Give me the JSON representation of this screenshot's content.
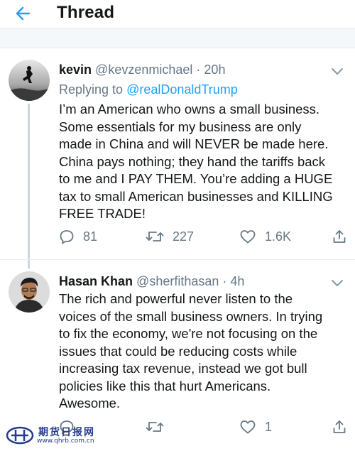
{
  "header": {
    "title": "Thread",
    "back_icon": "arrow-left-icon"
  },
  "tweets": [
    {
      "name": "kevin",
      "handle": "@kevzenmichael",
      "separator": "·",
      "time": "20h",
      "replying_prefix": "Replying to ",
      "replying_to": "@realDonaldTrump",
      "lines": [
        "I’m an American who owns a small business.",
        "Some essentials for my business are only",
        "made in China and will NEVER be made here.",
        "China pays nothing; they hand the tariffs back",
        "to me and I PAY THEM. You’re adding a HUGE",
        "tax to small American businesses and KILLING",
        "FREE TRADE!"
      ],
      "stats": {
        "replies": "81",
        "retweets": "227",
        "likes": "1.6K"
      }
    },
    {
      "name": "Hasan Khan",
      "handle": "@sherfithasan",
      "separator": "·",
      "time": "4h",
      "lines": [
        "The rich and powerful never listen to the",
        "voices of the small business owners. In trying",
        "to fix the economy, we're not focusing on the",
        "issues that could be reducing costs while",
        "increasing tax revenue, instead we got bull",
        "policies like this that hurt Americans.",
        "Awesome."
      ],
      "stats": {
        "replies": "",
        "retweets": "",
        "likes": "1"
      }
    }
  ],
  "icons": {
    "reply": "reply-icon",
    "retweet": "retweet-icon",
    "like": "heart-icon",
    "share": "share-icon",
    "caret": "chevron-down-icon"
  },
  "colors": {
    "accent": "#1da1f2",
    "secondary_text": "#657786",
    "primary_text": "#14171a",
    "watermark": "#243c8c"
  },
  "watermark": {
    "cn": "期货日报网",
    "url": "www.qhrb.com.cn"
  }
}
